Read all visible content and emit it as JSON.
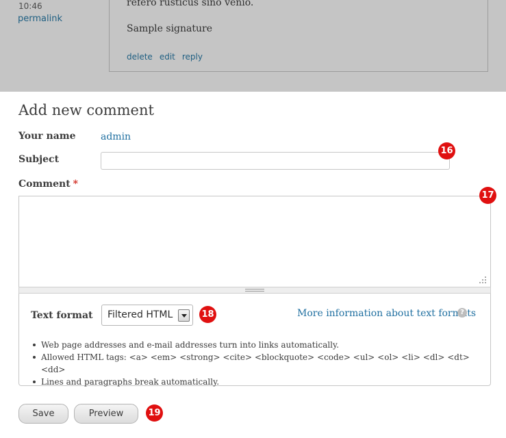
{
  "previous_comment": {
    "time": "10:46",
    "permalink": "permalink",
    "body": "refero rusticus sino venio.",
    "signature": "Sample signature",
    "links": [
      "delete",
      "edit",
      "reply"
    ]
  },
  "form": {
    "heading": "Add new comment",
    "name_label": "Your name",
    "name_value": "admin",
    "subject_label": "Subject",
    "subject_value": "",
    "comment_label": "Comment",
    "required_mark": "*",
    "comment_value": ""
  },
  "text_format": {
    "label": "Text format",
    "selected": "Filtered HTML",
    "more_info": "More information about text formats",
    "help_icon": "?",
    "tips": [
      "Web page addresses and e-mail addresses turn into links automatically.",
      "Allowed HTML tags: <a> <em> <strong> <cite> <blockquote> <code> <ul> <ol> <li> <dl> <dt> <dd>",
      "Lines and paragraphs break automatically."
    ]
  },
  "buttons": {
    "save": "Save",
    "preview": "Preview"
  },
  "markers": [
    "16",
    "17",
    "18",
    "19"
  ],
  "colors": {
    "link": "#1f6fa0",
    "marker": "#e01010",
    "overlay": "#c5c5c5",
    "required": "#d0271d"
  },
  "icons": {
    "help": "help-circle-icon",
    "resize": "resize-grip-icon",
    "dropdown": "chevron-down-icon"
  }
}
